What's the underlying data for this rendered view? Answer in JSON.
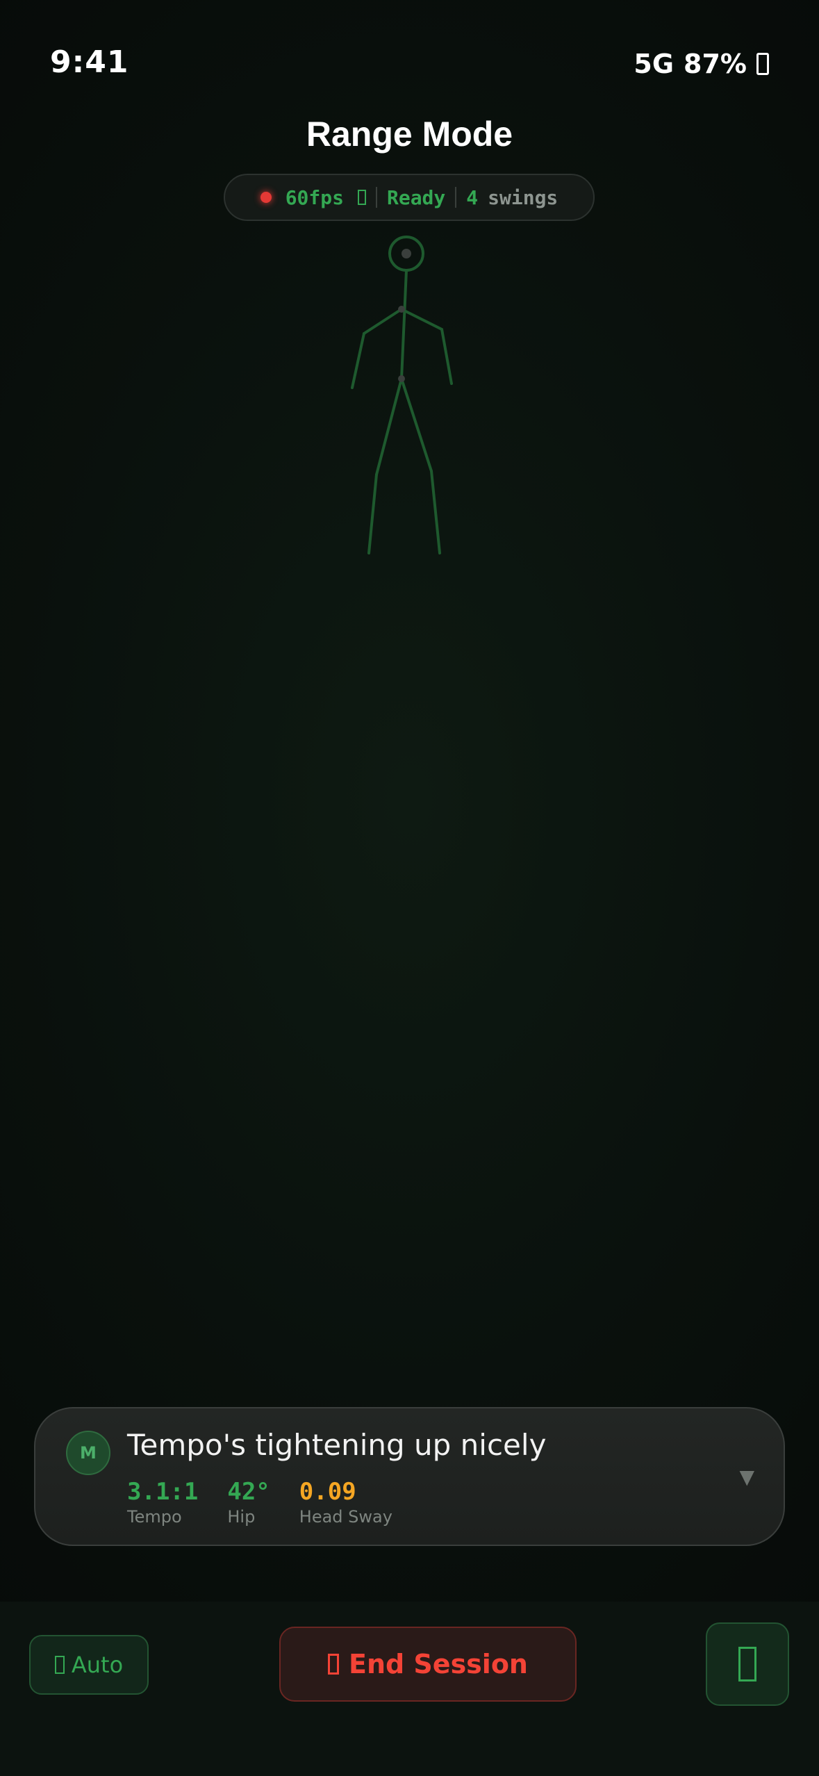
{
  "status_bar": {
    "time": "9:41",
    "network": "5G",
    "battery": "87%",
    "battery_icon": "battery-icon"
  },
  "header": {
    "title": "Range Mode"
  },
  "status_pill": {
    "fps": "60fps",
    "state": "Ready",
    "swing_count": "4",
    "swing_unit": "swings",
    "rec_color": "#e53935"
  },
  "coach": {
    "avatar_initial": "M",
    "message": "Tempo's tightening up nicely",
    "expand_glyph": "▼",
    "metrics": [
      {
        "value": "3.1:1",
        "label": "Tempo",
        "color": "#34a853"
      },
      {
        "value": "42°",
        "label": "Hip",
        "color": "#34a853"
      },
      {
        "value": "0.09",
        "label": "Head Sway",
        "color": "#f5a623"
      }
    ]
  },
  "controls": {
    "auto_label": "Auto",
    "end_label": "End Session",
    "camera_icon": "camera-icon"
  },
  "colors": {
    "accent": "#34a853",
    "danger": "#f44336",
    "warning": "#f5a623",
    "skeleton": "#1e5a2e"
  }
}
